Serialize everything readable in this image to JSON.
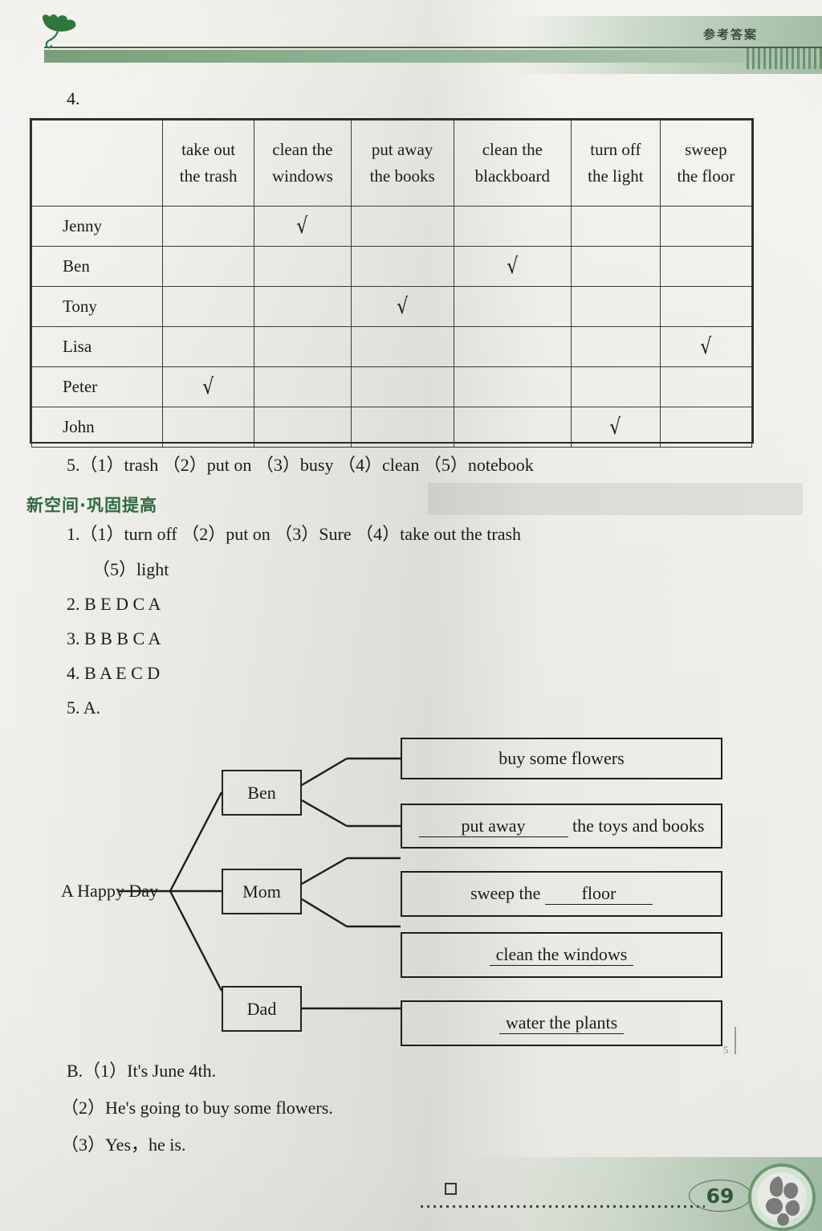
{
  "header": {
    "title": "参考答案",
    "logo_icon": "ginkgo-leaf-icon"
  },
  "exercise4": {
    "number": "4.",
    "table": {
      "columns": [
        {
          "line1": "",
          "line2": ""
        },
        {
          "line1": "take out",
          "line2": "the trash"
        },
        {
          "line1": "clean the",
          "line2": "windows"
        },
        {
          "line1": "put away",
          "line2": "the books"
        },
        {
          "line1": "clean the",
          "line2": "blackboard"
        },
        {
          "line1": "turn off",
          "line2": "the light"
        },
        {
          "line1": "sweep",
          "line2": "the floor"
        }
      ],
      "check_glyph": "√",
      "rows": [
        {
          "name": "Jenny",
          "checked": 2
        },
        {
          "name": "Ben",
          "checked": 4
        },
        {
          "name": "Tony",
          "checked": 3
        },
        {
          "name": "Lisa",
          "checked": 6
        },
        {
          "name": "Peter",
          "checked": 1
        },
        {
          "name": "John",
          "checked": 5
        }
      ]
    }
  },
  "exercise5_top": {
    "line": "5.（1）trash    （2）put on    （3）busy    （4）clean    （5）notebook"
  },
  "section": {
    "heading": "新空间·巩固提高",
    "heading_color": "#2f6b42"
  },
  "answers": {
    "item1_line1": "1.（1）turn off    （2）put on    （3）Sure    （4）take out the trash",
    "item1_line2": "（5）light",
    "item2": "2. B   E   D   C   A",
    "item3": "3. B   B   B   C   A",
    "item4": "4. B   A   E   C   D",
    "item5": "5. A."
  },
  "diagram": {
    "root_label": "A Happy Day",
    "nodes": [
      {
        "label": "Ben"
      },
      {
        "label": "Mom"
      },
      {
        "label": "Dad"
      }
    ],
    "answer_boxes": [
      {
        "prefix": "",
        "blank": "buy some flowers",
        "suffix": "",
        "underlined": false
      },
      {
        "prefix": "",
        "blank": "put away",
        "suffix": " the toys and books",
        "underlined": true
      },
      {
        "prefix": "sweep the ",
        "blank": "floor",
        "suffix": "",
        "underlined": true
      },
      {
        "prefix": "",
        "blank": "clean the windows",
        "suffix": "",
        "underlined": true
      },
      {
        "prefix": "",
        "blank": "water the plants",
        "suffix": "",
        "underlined": true
      }
    ],
    "margin_mark": "5"
  },
  "partB": {
    "line1": "B.（1）It's June 4th.",
    "line2": "（2）He's going to buy some flowers.",
    "line3": "（3）Yes，he is."
  },
  "footer": {
    "page_number": "69",
    "emblem_icon": "flower-emblem-icon"
  }
}
